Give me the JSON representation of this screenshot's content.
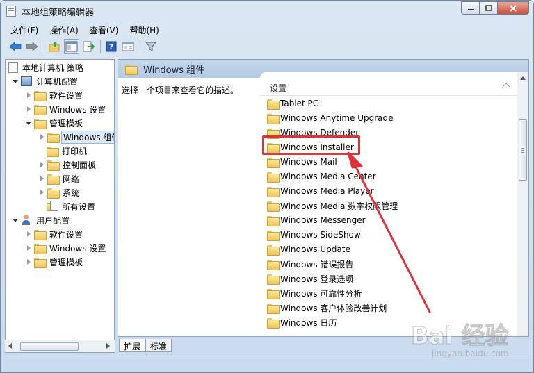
{
  "window": {
    "title": "本地组策略编辑器"
  },
  "menu": [
    "文件(F)",
    "操作(A)",
    "查看(V)",
    "帮助(H)"
  ],
  "toolbar_icons": [
    "back-arrow-icon",
    "forward-arrow-icon",
    "up-folder-icon",
    "show-hide-tree-icon",
    "export-list-icon",
    "help-icon",
    "properties-icon",
    "filter-icon"
  ],
  "tree": {
    "root": "本地计算机 策略",
    "computer_config": "计算机配置",
    "computer_children": {
      "software": "软件设置",
      "windows": "Windows 设置",
      "admin_templates": "管理模板"
    },
    "admin_children": {
      "windows_components": "Windows 组件",
      "printers": "打印机",
      "control_panel": "控制面板",
      "network": "网络",
      "system": "系统",
      "all_settings": "所有设置"
    },
    "user_config": "用户配置",
    "user_children": {
      "software": "软件设置",
      "windows": "Windows 设置",
      "admin_templates": "管理模板"
    }
  },
  "right_pane": {
    "header": "Windows 组件",
    "description": "选择一个项目来查看它的描述。",
    "column_header": "设置",
    "items": [
      "Tablet PC",
      "Windows Anytime Upgrade",
      "Windows Defender",
      "Windows Installer",
      "Windows Mail",
      "Windows Media Center",
      "Windows Media Player",
      "Windows Media 数字权限管理",
      "Windows Messenger",
      "Windows SideShow",
      "Windows Update",
      "Windows 错误报告",
      "Windows 登录选项",
      "Windows 可靠性分析",
      "Windows 客户体验改善计划",
      "Windows 日历"
    ],
    "highlighted_item": "Windows Installer"
  },
  "tabs": [
    "扩展",
    "标准"
  ],
  "watermark": {
    "main": "Bai 经验",
    "sub": "jingyan.baidu.com"
  },
  "colors": {
    "annotation": "#e0313a",
    "selection": "#dce9f7"
  }
}
